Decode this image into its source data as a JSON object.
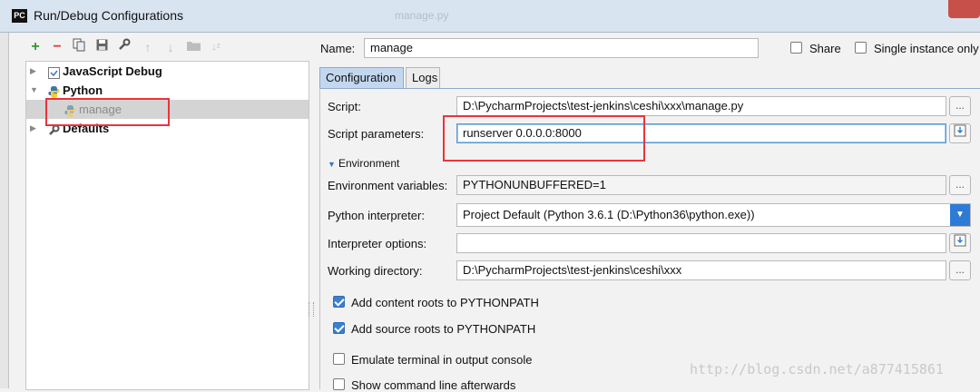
{
  "window": {
    "title": "Run/Debug Configurations",
    "logo": "PC",
    "background_tab": "manage.py"
  },
  "toolbar": {
    "icons": [
      "plus-icon",
      "minus-icon",
      "copy-icon",
      "save-icon",
      "wrench-icon",
      "arrow-up-icon",
      "arrow-down-icon",
      "folder-icon",
      "sort-icon"
    ]
  },
  "tree": {
    "items": [
      {
        "label": "JavaScript Debug",
        "icon": "javascript-debug-icon",
        "expanded": false
      },
      {
        "label": "Python",
        "icon": "python-icon",
        "expanded": true
      },
      {
        "label": "manage",
        "icon": "python-file-icon",
        "selected": true
      },
      {
        "label": "Defaults",
        "icon": "wrench-icon",
        "expanded": false
      }
    ]
  },
  "form": {
    "name_label": "Name:",
    "name_value": "manage",
    "share_label": "Share",
    "share_checked": false,
    "single_instance_label": "Single instance only",
    "single_instance_checked": false
  },
  "tabs": [
    {
      "label": "Configuration",
      "active": true
    },
    {
      "label": "Logs",
      "active": false
    }
  ],
  "config": {
    "script_label": "Script:",
    "script_value": "D:\\PycharmProjects\\test-jenkins\\ceshi\\xxx\\manage.py",
    "script_params_label": "Script parameters:",
    "script_params_value": "runserver 0.0.0.0:8000",
    "environment_section": "Environment",
    "env_vars_label": "Environment variables:",
    "env_vars_value": "PYTHONUNBUFFERED=1",
    "interpreter_label": "Python interpreter:",
    "interpreter_value": "Project Default (Python 3.6.1 (D:\\Python36\\python.exe))",
    "interpreter_options_label": "Interpreter options:",
    "interpreter_options_value": "",
    "working_dir_label": "Working directory:",
    "working_dir_value": "D:\\PycharmProjects\\test-jenkins\\ceshi\\xxx",
    "ellipsis": "...",
    "checkboxes": [
      {
        "label": "Add content roots to PYTHONPATH",
        "checked": true
      },
      {
        "label": "Add source roots to PYTHONPATH",
        "checked": true
      },
      {
        "label": "Emulate terminal in output console",
        "checked": false
      },
      {
        "label": "Show command line afterwards",
        "checked": false
      }
    ]
  },
  "watermark": "http://blog.csdn.net/a877415861",
  "colors": {
    "accent": "#2e7bd6",
    "highlight_box": "#e8353c",
    "selected_row": "#d4d4d4",
    "tab_active": "#c3d7ef"
  }
}
